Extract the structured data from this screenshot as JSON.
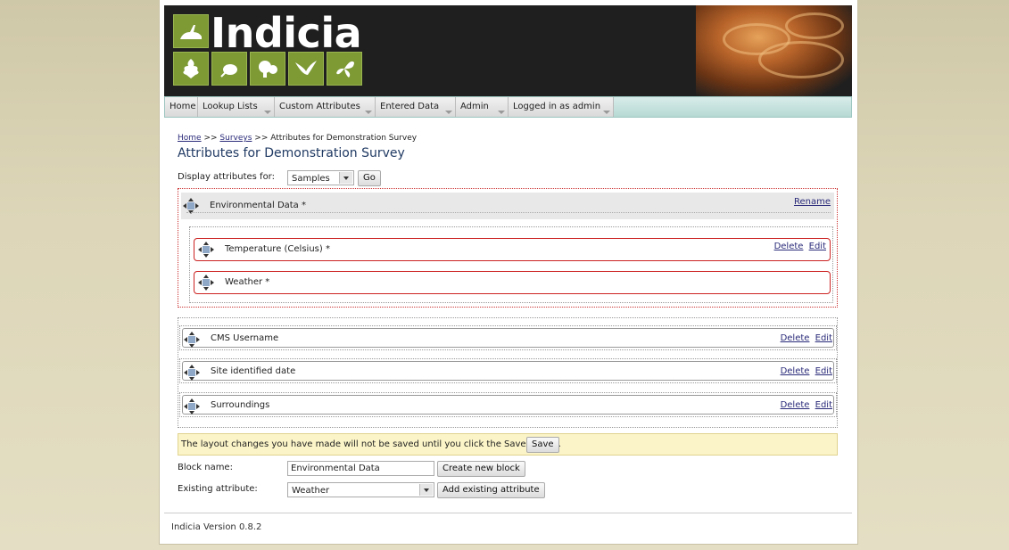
{
  "header": {
    "logo_text": "Indicia"
  },
  "menu": {
    "items": [
      {
        "label": "Home",
        "has_dropdown": false
      },
      {
        "label": "Lookup Lists",
        "has_dropdown": true
      },
      {
        "label": "Custom Attributes",
        "has_dropdown": true
      },
      {
        "label": "Entered Data",
        "has_dropdown": true
      },
      {
        "label": "Admin",
        "has_dropdown": true
      },
      {
        "label": "Logged in as admin",
        "has_dropdown": true
      }
    ]
  },
  "breadcrumb": {
    "home": "Home",
    "sep1": ">>",
    "surveys": "Surveys",
    "sep2": ">>",
    "current": "Attributes for Demonstration Survey"
  },
  "page_title": "Attributes for Demonstration Survey",
  "display_for": {
    "label": "Display attributes for:",
    "value": "Samples",
    "go_label": "Go"
  },
  "block": {
    "name": "Environmental Data *",
    "rename_label": "Rename",
    "attributes": [
      {
        "name": "Temperature (Celsius) *",
        "delete": "Delete",
        "edit": "Edit"
      },
      {
        "name": "Weather *"
      }
    ]
  },
  "loose_attributes": [
    {
      "name": "CMS Username",
      "delete": "Delete",
      "edit": "Edit"
    },
    {
      "name": "Site identified date",
      "delete": "Delete",
      "edit": "Edit"
    },
    {
      "name": "Surroundings",
      "delete": "Delete",
      "edit": "Edit"
    }
  ],
  "notice": {
    "text": "The layout changes you have made will not be saved until you click the Save button.",
    "save_label": "Save"
  },
  "block_form": {
    "label": "Block name:",
    "value": "Environmental Data",
    "button": "Create new block"
  },
  "existing_form": {
    "label": "Existing attribute:",
    "value": "Weather",
    "button": "Add existing attribute"
  },
  "footer": {
    "version": "Indicia Version 0.8.2"
  },
  "colors": {
    "accent_green": "#7d9a35",
    "title_blue": "#203a63",
    "menu_teal": "#b6d9d4",
    "error_red": "#cc2222",
    "notice_yellow": "#fbf4c8"
  }
}
